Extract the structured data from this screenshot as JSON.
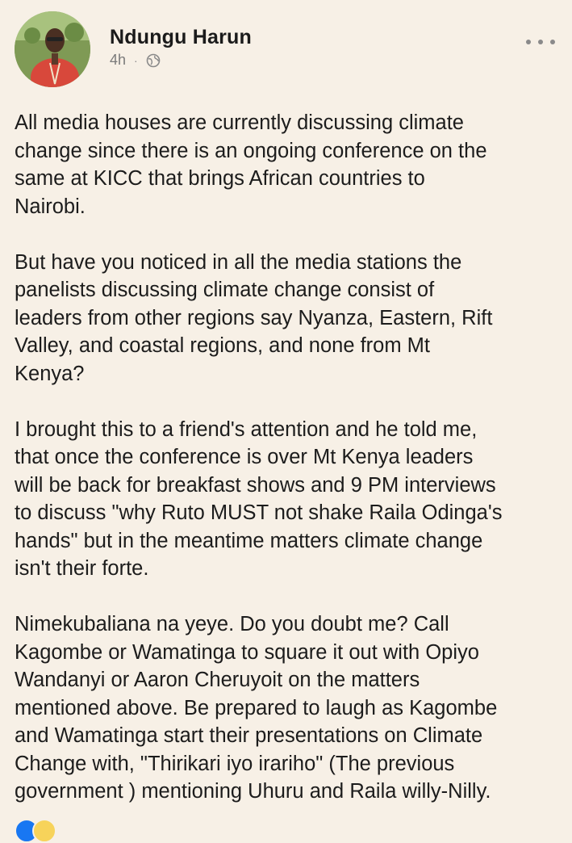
{
  "post": {
    "author": "Ndungu Harun",
    "time": "4h",
    "separator": "·",
    "visibility_icon": "globe-icon",
    "more_icon": "more-options-icon",
    "paragraphs": [
      "All media houses are currently discussing climate\nchange since there is an ongoing conference on the\nsame at KICC that brings African countries to\nNairobi.",
      "But have you noticed in all the media stations the\npanelists discussing climate change consist of\nleaders from other regions say Nyanza, Eastern, Rift\nValley, and coastal regions, and none from Mt\nKenya?",
      "I brought this to a friend's attention and he told me,\nthat once the conference is over Mt Kenya leaders\nwill be back for breakfast shows and 9 PM interviews\nto discuss \"why Ruto MUST not shake Raila Odinga's\nhands\" but in the meantime matters climate change\nisn't their forte.",
      "Nimekubaliana na yeye. Do you doubt me? Call\nKagombe or Wamatinga to square it out with Opiyo\nWandanyi or Aaron Cheruyoit on the matters\nmentioned above. Be prepared to laugh as Kagombe\nand Wamatinga start their presentations on Climate\nChange with, \"Thirikari iyo irariho\" (The previous\ngovernment ) mentioning Uhuru and Raila willy-Nilly."
    ]
  },
  "colors": {
    "background": "#f7f0e6",
    "text": "#1c1c1c",
    "meta": "#7a7a7a",
    "like": "#1877f2",
    "love": "#f7d35a"
  }
}
